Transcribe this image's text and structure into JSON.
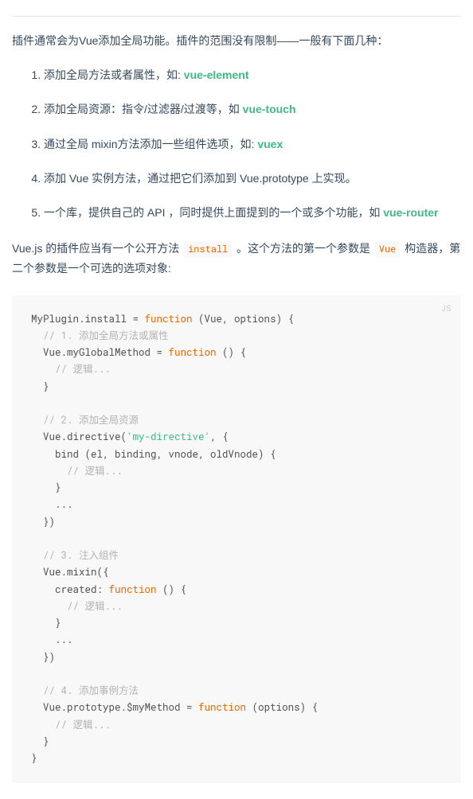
{
  "intro": "插件通常会为Vue添加全局功能。插件的范围没有限制——一般有下面几种：",
  "list": [
    {
      "prefix": "添加全局方法或者属性，如: ",
      "link": "vue-element",
      "suffix": ""
    },
    {
      "prefix": "添加全局资源：指令/过滤器/过渡等，如 ",
      "link": "vue-touch",
      "suffix": ""
    },
    {
      "prefix": "通过全局 mixin方法添加一些组件选项，如: ",
      "link": "vuex",
      "suffix": ""
    },
    {
      "prefix": "添加 Vue 实例方法，通过把它们添加到 Vue.prototype 上实现。",
      "link": "",
      "suffix": ""
    },
    {
      "prefix": "一个库，提供自己的 API ，同时提供上面提到的一个或多个功能，如 ",
      "link": "vue-router",
      "suffix": ""
    }
  ],
  "install_desc": {
    "seg1": "Vue.js 的插件应当有一个公开方法 ",
    "code1": "install",
    "seg2": " 。这个方法的第一个参数是 ",
    "code2": "Vue",
    "seg3": " 构造器，第二个参数是一个可选的选项对象:"
  },
  "code": {
    "lang": "JS",
    "lines": [
      {
        "t": "plain",
        "v": "MyPlugin.install = "
      },
      {
        "t": "kw",
        "v": "function"
      },
      {
        "t": "plain",
        "v": " (Vue, options) {"
      },
      {
        "t": "nl"
      },
      {
        "t": "plain",
        "v": "  "
      },
      {
        "t": "cmt",
        "v": "// 1. 添加全局方法或属性"
      },
      {
        "t": "nl"
      },
      {
        "t": "plain",
        "v": "  Vue.myGlobalMethod = "
      },
      {
        "t": "kw",
        "v": "function"
      },
      {
        "t": "plain",
        "v": " () {"
      },
      {
        "t": "nl"
      },
      {
        "t": "plain",
        "v": "    "
      },
      {
        "t": "cmt",
        "v": "// 逻辑..."
      },
      {
        "t": "nl"
      },
      {
        "t": "plain",
        "v": "  }"
      },
      {
        "t": "nl"
      },
      {
        "t": "nl"
      },
      {
        "t": "plain",
        "v": "  "
      },
      {
        "t": "cmt",
        "v": "// 2. 添加全局资源"
      },
      {
        "t": "nl"
      },
      {
        "t": "plain",
        "v": "  Vue.directive("
      },
      {
        "t": "str",
        "v": "'my-directive'"
      },
      {
        "t": "plain",
        "v": ", {"
      },
      {
        "t": "nl"
      },
      {
        "t": "plain",
        "v": "    bind (el, binding, vnode, oldVnode) {"
      },
      {
        "t": "nl"
      },
      {
        "t": "plain",
        "v": "      "
      },
      {
        "t": "cmt",
        "v": "// 逻辑..."
      },
      {
        "t": "nl"
      },
      {
        "t": "plain",
        "v": "    }"
      },
      {
        "t": "nl"
      },
      {
        "t": "plain",
        "v": "    ..."
      },
      {
        "t": "nl"
      },
      {
        "t": "plain",
        "v": "  })"
      },
      {
        "t": "nl"
      },
      {
        "t": "nl"
      },
      {
        "t": "plain",
        "v": "  "
      },
      {
        "t": "cmt",
        "v": "// 3. 注入组件"
      },
      {
        "t": "nl"
      },
      {
        "t": "plain",
        "v": "  Vue.mixin({"
      },
      {
        "t": "nl"
      },
      {
        "t": "plain",
        "v": "    created: "
      },
      {
        "t": "kw",
        "v": "function"
      },
      {
        "t": "plain",
        "v": " () {"
      },
      {
        "t": "nl"
      },
      {
        "t": "plain",
        "v": "      "
      },
      {
        "t": "cmt",
        "v": "// 逻辑..."
      },
      {
        "t": "nl"
      },
      {
        "t": "plain",
        "v": "    }"
      },
      {
        "t": "nl"
      },
      {
        "t": "plain",
        "v": "    ..."
      },
      {
        "t": "nl"
      },
      {
        "t": "plain",
        "v": "  })"
      },
      {
        "t": "nl"
      },
      {
        "t": "nl"
      },
      {
        "t": "plain",
        "v": "  "
      },
      {
        "t": "cmt",
        "v": "// 4. 添加事例方法"
      },
      {
        "t": "nl"
      },
      {
        "t": "plain",
        "v": "  Vue.prototype.$myMethod = "
      },
      {
        "t": "kw",
        "v": "function"
      },
      {
        "t": "plain",
        "v": " (options) {"
      },
      {
        "t": "nl"
      },
      {
        "t": "plain",
        "v": "    "
      },
      {
        "t": "cmt",
        "v": "// 逻辑..."
      },
      {
        "t": "nl"
      },
      {
        "t": "plain",
        "v": "  }"
      },
      {
        "t": "nl"
      },
      {
        "t": "plain",
        "v": "}"
      }
    ]
  }
}
